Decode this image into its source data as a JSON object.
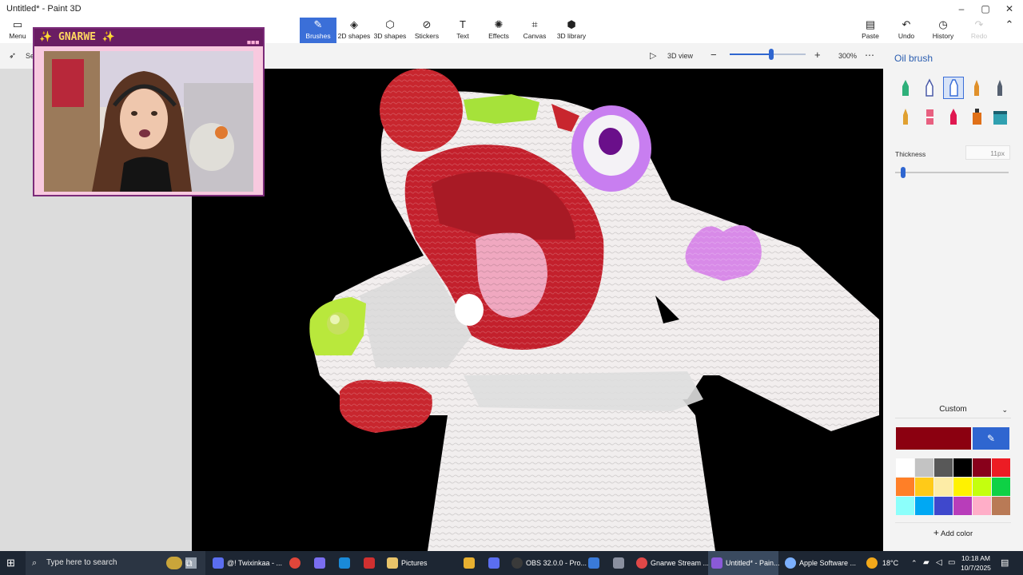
{
  "window": {
    "title": "Untitled* - Paint 3D"
  },
  "ribbon": {
    "menu": "Menu",
    "tools": [
      {
        "label": "Brushes",
        "icon": "brush-icon",
        "active": true
      },
      {
        "label": "2D shapes",
        "icon": "2d-shapes-icon"
      },
      {
        "label": "3D shapes",
        "icon": "3d-shapes-icon"
      },
      {
        "label": "Stickers",
        "icon": "stickers-icon"
      },
      {
        "label": "Text",
        "icon": "text-icon"
      },
      {
        "label": "Effects",
        "icon": "effects-icon"
      },
      {
        "label": "Canvas",
        "icon": "canvas-icon"
      },
      {
        "label": "3D library",
        "icon": "3d-library-icon"
      }
    ],
    "right": [
      {
        "label": "Paste",
        "icon": "paste-icon"
      },
      {
        "label": "Undo",
        "icon": "undo-icon"
      },
      {
        "label": "History",
        "icon": "history-icon"
      },
      {
        "label": "Redo",
        "icon": "redo-icon",
        "disabled": true
      }
    ]
  },
  "toolbar": {
    "select_label": "Se",
    "view3d_label": "3D view",
    "zoom_value": "300%",
    "zoom_fraction": 0.55,
    "more": "⋯"
  },
  "panel": {
    "title": "Oil brush",
    "brushes": [
      {
        "name": "marker",
        "color": "#2eb07a"
      },
      {
        "name": "calligraphy-pen",
        "color": "#4a5aa8"
      },
      {
        "name": "oil-brush",
        "color": "#3b6fd8",
        "selected": true
      },
      {
        "name": "watercolor",
        "color": "#e0902a"
      },
      {
        "name": "pixel-pen",
        "color": "#556070"
      },
      {
        "name": "pencil",
        "color": "#e0a030"
      },
      {
        "name": "eraser",
        "color": "#e86080"
      },
      {
        "name": "crayon",
        "color": "#e01850"
      },
      {
        "name": "spray-can",
        "color": "#e07018"
      },
      {
        "name": "fill",
        "color": "#30a0b0"
      }
    ],
    "thickness_label": "Thickness",
    "thickness_value": "11px",
    "thickness_fraction": 0.05,
    "color_mode": "Custom",
    "current_color": "#8b0010",
    "palette": [
      "#ffffff",
      "#c3c3c3",
      "#585858",
      "#000000",
      "#88001b",
      "#ec1c24",
      "#ff7f27",
      "#ffca18",
      "#fdeca6",
      "#fff200",
      "#c4ff0e",
      "#0ed145",
      "#8cfffb",
      "#00a8f3",
      "#3f48cc",
      "#b83dba",
      "#ffaec8",
      "#b97a56"
    ],
    "add_color": "Add color"
  },
  "overlay": {
    "name_text": "✨ GNARWE ✨"
  },
  "taskbar": {
    "search_placeholder": "Type here to search",
    "items": [
      {
        "label": "@! Twixinkaa - ...",
        "icon_color": "#5b6ef0"
      },
      {
        "label": "Pictures",
        "icon_color": "#e9c46a"
      },
      {
        "label": "OBS 32.0.0 - Pro...",
        "icon_color": "#3a3a3a"
      },
      {
        "label": "Gnarwe Stream ...",
        "icon_color": "#e04848"
      },
      {
        "label": "Untitled* - Pain...",
        "icon_color": "#8a5ad8",
        "active": true
      },
      {
        "label": "Apple Software ...",
        "icon_color": "#7bb0ff"
      }
    ],
    "weather": "18°C",
    "time": "10:18 AM",
    "date": "10/7/2025"
  }
}
